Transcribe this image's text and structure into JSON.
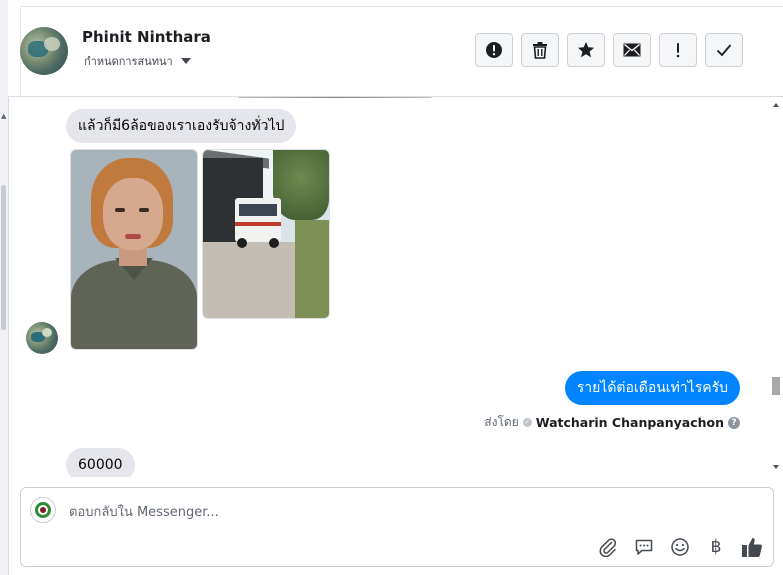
{
  "header": {
    "contact_name": "Phinit Ninthara",
    "assign_label": "กำหนดการสนทนา",
    "toolbar": [
      {
        "icon": "exclamation-circle-icon"
      },
      {
        "icon": "trash-icon"
      },
      {
        "icon": "star-icon"
      },
      {
        "icon": "envelope-icon"
      },
      {
        "icon": "exclamation-icon"
      },
      {
        "icon": "checkmark-icon"
      }
    ]
  },
  "conversation": {
    "messages": [
      {
        "direction": "incoming",
        "text": "แล้วก็มี6ล้อของเราเองรับจ้างทั่วไป"
      },
      {
        "direction": "incoming",
        "type": "photos",
        "count": 2
      },
      {
        "direction": "outgoing",
        "text": "รายได้ต่อเดือนเท่าไรครับ"
      },
      {
        "direction": "incoming",
        "text": "60000"
      }
    ],
    "sent_by_label": "ส่งโดย",
    "sent_by_name": "Watcharin Chanpanyachon"
  },
  "composer": {
    "placeholder": "ตอบกลับใน Messenger...",
    "icons": [
      "paperclip-icon",
      "saved-reply-icon",
      "emoji-icon",
      "baht-icon",
      "like-icon"
    ],
    "baht_symbol": "฿"
  },
  "colors": {
    "outgoing_bubble": "#0084ff",
    "incoming_bubble": "#e4e6eb",
    "toolbar_button_bg": "#f5f6f7"
  }
}
